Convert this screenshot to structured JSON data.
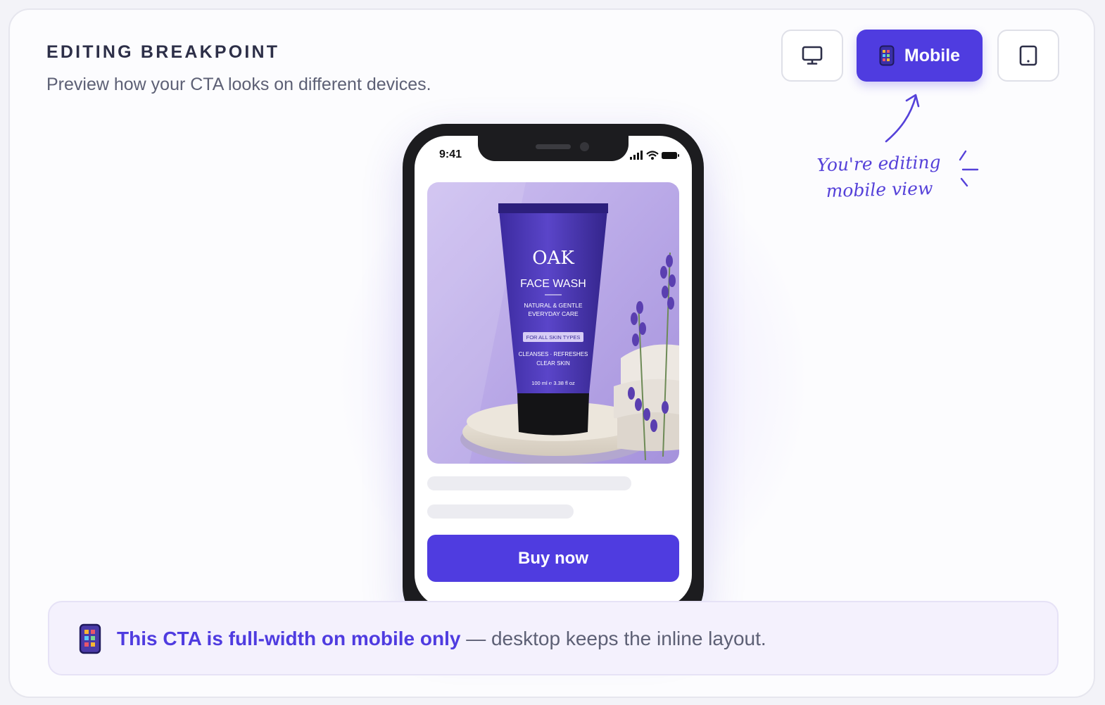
{
  "header": {
    "title": "EDITING BREAKPOINT",
    "subtitle": "Preview how your CTA looks on different devices."
  },
  "device_switcher": {
    "options": [
      {
        "id": "desktop",
        "icon": "desktop-icon",
        "label": "",
        "active": false
      },
      {
        "id": "mobile",
        "icon": "mobile-icon",
        "label": "Mobile",
        "active": true
      },
      {
        "id": "tablet",
        "icon": "tablet-icon",
        "label": "",
        "active": false
      }
    ]
  },
  "annotation": {
    "line1": "You're editing",
    "line2": "mobile view"
  },
  "phone": {
    "status_time": "9:41",
    "product": {
      "brand": "OAK",
      "name": "FACE WASH",
      "tagline1": "NATURAL & GENTLE",
      "tagline2": "EVERYDAY CARE",
      "badge": "FOR ALL SKIN TYPES",
      "benefit1": "CLEANSES · REFRESHES",
      "benefit2": "CLEAR SKIN",
      "volume": "100 ml ℮ 3.38 fl oz"
    },
    "cta_label": "Buy now"
  },
  "banner": {
    "strong_text": "This CTA is full-width on mobile only",
    "rest_text": " — desktop keeps the inline layout."
  },
  "colors": {
    "accent": "#4f3ce0",
    "heading": "#2d2f48",
    "muted": "#5d6075",
    "banner_bg": "#f4f1fd"
  }
}
